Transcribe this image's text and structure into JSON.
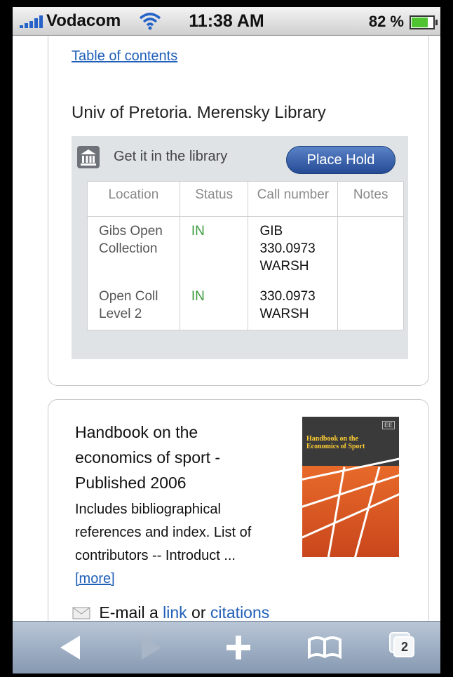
{
  "status_bar": {
    "carrier": "Vodacom",
    "time": "11:38 AM",
    "battery": "82 %",
    "battery_level": 0.82
  },
  "holdings_card": {
    "toc_link": "Table of contents",
    "library_name": "Univ of Pretoria. Merensky Library",
    "get_it_label": "Get it in the library",
    "place_hold_label": "Place Hold",
    "columns": [
      "Location",
      "Status",
      "Call number",
      "Notes"
    ],
    "rows": [
      {
        "location": "Gibs Open Collection",
        "status": "IN",
        "call_number": "GIB 330.0973 WARSH",
        "notes": ""
      },
      {
        "location": "Open Coll Level 2",
        "status": "IN",
        "call_number": "330.0973 WARSH",
        "notes": ""
      }
    ]
  },
  "book_card": {
    "title": "Handbook on the economics of sport - Published 2006",
    "description": "Includes bibliographical references and index. List of contributors -- Introduct ...",
    "more_link": "[more]",
    "cover_title": "Handbook on the Economics of Sport",
    "email_prefix": "E-mail a",
    "email_link": "link",
    "email_or": "or",
    "email_citations": "citations"
  },
  "toolbar": {
    "tab_count": "2"
  },
  "colors": {
    "link": "#2060b8",
    "status_in": "#3c9a3c",
    "button": "#244b94"
  }
}
